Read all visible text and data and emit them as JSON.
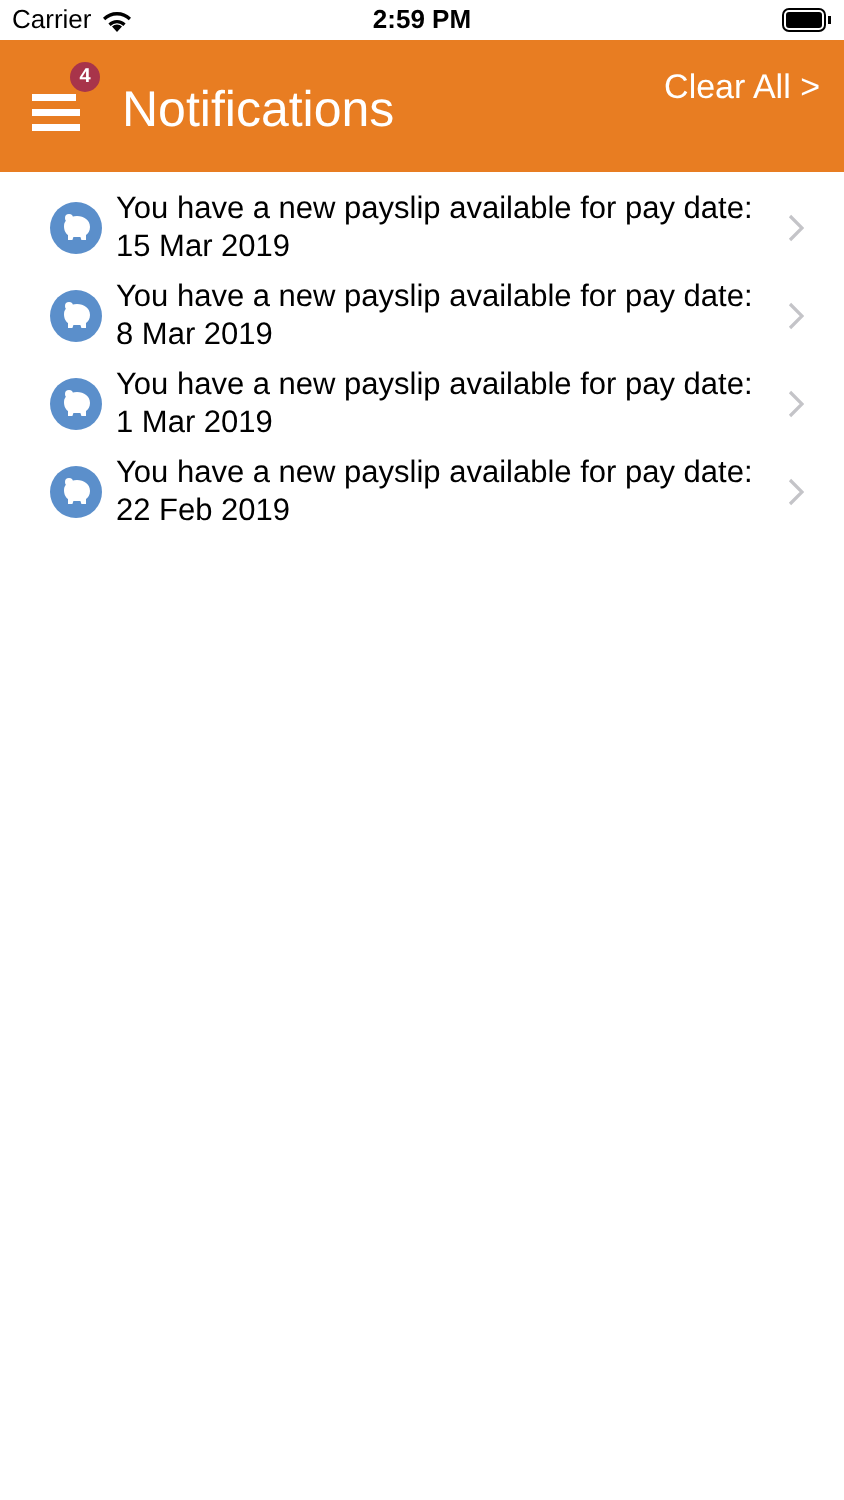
{
  "status_bar": {
    "carrier": "Carrier",
    "time": "2:59 PM"
  },
  "header": {
    "badge": "4",
    "title": "Notifications",
    "action": "Clear All >"
  },
  "notifications": [
    {
      "message": "You have a new payslip available for pay date:",
      "date": "15 Mar 2019"
    },
    {
      "message": "You have a new payslip available for pay date:",
      "date": "8 Mar 2019"
    },
    {
      "message": "You have a new payslip available for pay date:",
      "date": "1 Mar 2019"
    },
    {
      "message": "You have a new payslip available for pay date:",
      "date": "22 Feb 2019"
    }
  ]
}
